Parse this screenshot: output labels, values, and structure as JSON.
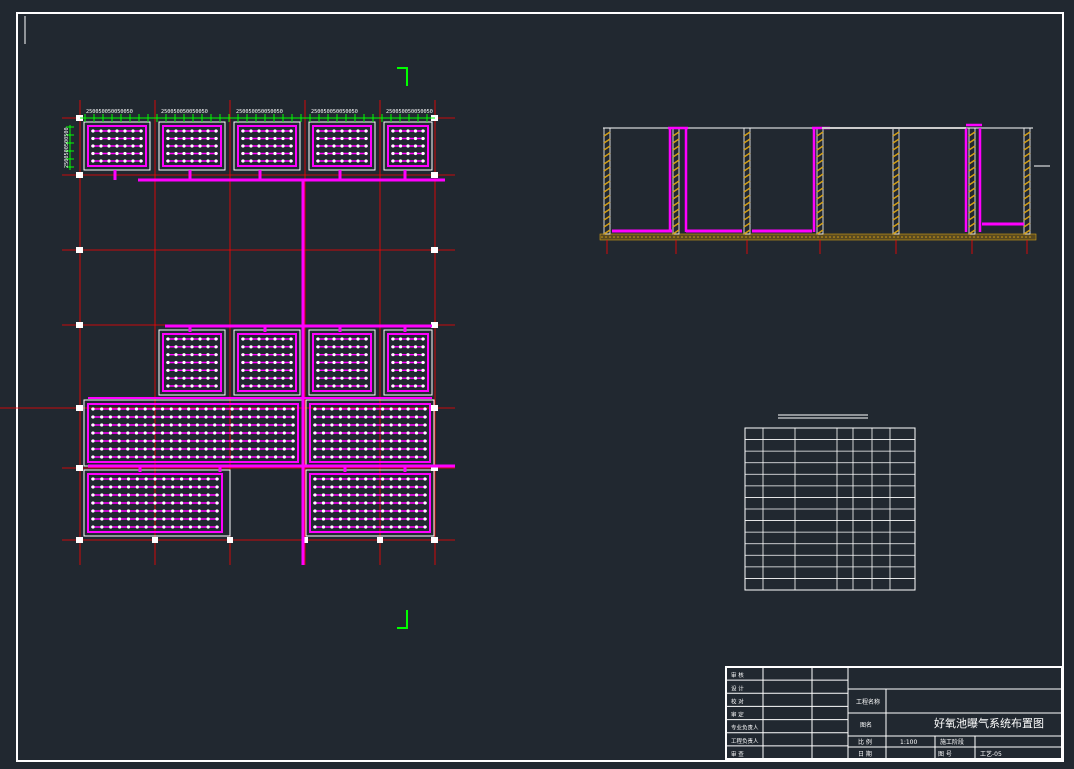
{
  "drawing": {
    "title": "好氧池曝气系统布置图",
    "project_label": "工程名称",
    "drawing_name_label": "图名",
    "scale_label": "比 例",
    "scale_value": "1:100",
    "date_label": "日 期",
    "stage_value": "施工阶段",
    "sheet_label": "图 号",
    "sheet_value": "工艺-05",
    "dim_string": "250050050050050",
    "dim_string_vertical": "2500500500500",
    "approval_rows": [
      "审 核",
      "设 计",
      "校 对",
      "审 定",
      "专业负责人",
      "工程负责人",
      "审 查"
    ]
  },
  "colors": {
    "background": "#212830",
    "frame": "#ffffff",
    "grid": "#ff0000",
    "pipe": "#ff00ff",
    "diffuser": "#ffffff",
    "wall": "#ffffff",
    "column": "#d4a017",
    "dimension": "#00ff00"
  },
  "material_table": {
    "columns": 8,
    "rows": 14
  }
}
